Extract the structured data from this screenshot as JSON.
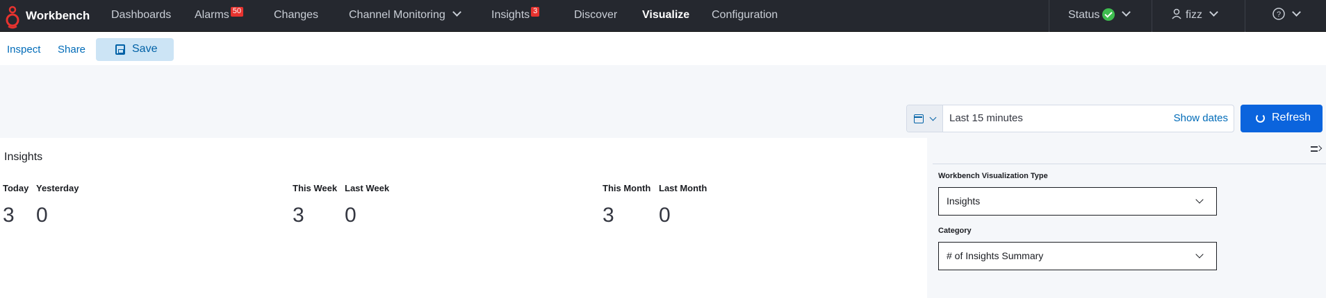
{
  "brand": {
    "name": "Workbench",
    "logo_icon": "genesys-logo-icon",
    "accent": "#e7332f"
  },
  "nav": {
    "dashboards": "Dashboards",
    "alarms": "Alarms",
    "alarms_badge": "50",
    "changes": "Changes",
    "channel_monitoring": "Channel Monitoring",
    "insights": "Insights",
    "insights_badge": "3",
    "discover": "Discover",
    "visualize": "Visualize",
    "configuration": "Configuration",
    "active": "Visualize"
  },
  "header_right": {
    "status_label": "Status",
    "status_color": "#3ebd4f",
    "user": "fizz",
    "help_icon": "help-icon"
  },
  "toolbar": {
    "inspect": "Inspect",
    "share": "Share",
    "save": "Save"
  },
  "datepicker": {
    "range": "Last 15 minutes",
    "show_dates": "Show dates",
    "refresh": "Refresh"
  },
  "panel": {
    "title": "Insights",
    "metrics": [
      {
        "label": "Today",
        "value": "3"
      },
      {
        "label": "Yesterday",
        "value": "0"
      },
      {
        "label": "This Week",
        "value": "3"
      },
      {
        "label": "Last Week",
        "value": "0"
      },
      {
        "label": "This Month",
        "value": "3"
      },
      {
        "label": "Last Month",
        "value": "0"
      }
    ]
  },
  "sidebar": {
    "viz_type_label": "Workbench Visualization Type",
    "viz_type_value": "Insights",
    "category_label": "Category",
    "category_value": "# of Insights Summary"
  }
}
